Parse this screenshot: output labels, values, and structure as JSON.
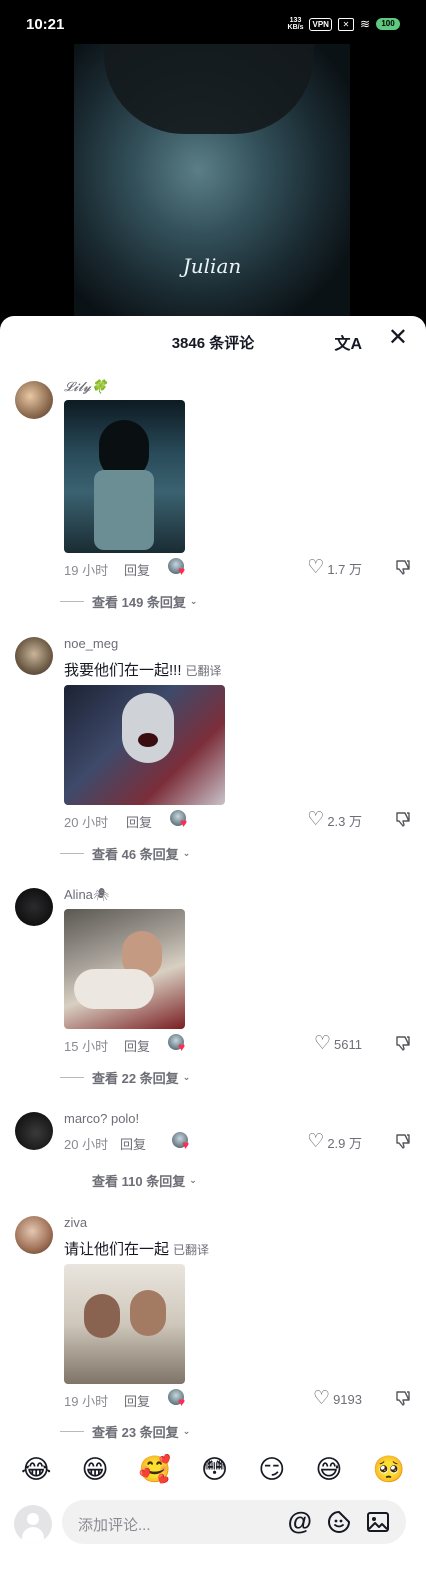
{
  "status_bar": {
    "time": "10:21",
    "net_speed_top": "133",
    "net_speed_bottom": "KB/s",
    "vpn": "VPN",
    "battery": "100"
  },
  "video": {
    "watermark": "Julian"
  },
  "comments_sheet": {
    "title": "3846 条评论",
    "translate_icon": "translate-icon",
    "close_icon": "close-icon"
  },
  "comments": [
    {
      "username": "𝓛𝓲𝓵𝔂🍀",
      "text": "",
      "time": "19 小时",
      "reply_label": "回复",
      "like_count": "1.7 万",
      "view_replies": "查看 149 条回复"
    },
    {
      "username": "noe_meg",
      "text": "我要他们在一起!!!",
      "translated_tag": "已翻译",
      "time": "20 小时",
      "reply_label": "回复",
      "like_count": "2.3 万",
      "view_replies": "查看 46 条回复"
    },
    {
      "username": "Alina🕷",
      "text": "",
      "time": "15 小时",
      "reply_label": "回复",
      "like_count": "5611",
      "view_replies": "查看 22 条回复"
    },
    {
      "username": "marco? polo!",
      "text": "",
      "time": "20 小时",
      "reply_label": "回复",
      "like_count": "2.9 万",
      "view_replies": "查看 110 条回复"
    },
    {
      "username": "ziva",
      "text": "请让他们在一起",
      "translated_tag": "已翻译",
      "time": "19 小时",
      "reply_label": "回复",
      "like_count": "9193",
      "view_replies": "查看 23 条回复"
    }
  ],
  "emoji_bar": [
    "😂",
    "😁",
    "🥰",
    "😳",
    "😏",
    "😅",
    "🥺"
  ],
  "input": {
    "placeholder": "添加评论...",
    "mention_symbol": "@"
  },
  "colors": {
    "like_accent": "#fe2c55",
    "sheet_bg": "#ffffff",
    "secondary_text": "#6d6e76"
  }
}
